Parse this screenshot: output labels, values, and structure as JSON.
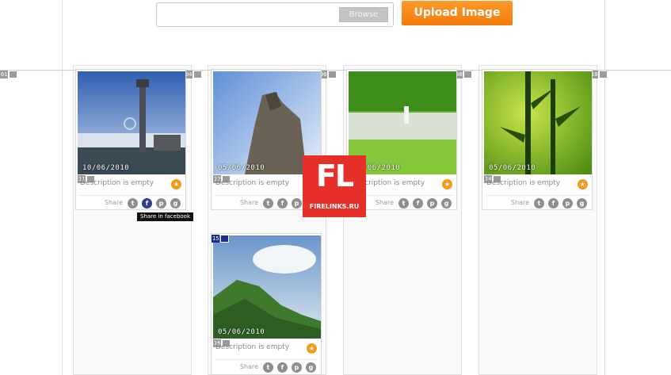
{
  "upload": {
    "field_value": "",
    "browse_label": "Browse",
    "upload_label": "Upload Image"
  },
  "guide_tags": [
    {
      "n": "01",
      "style": "grey"
    },
    {
      "n": "03",
      "style": "blue"
    },
    {
      "n": "04",
      "style": "grey"
    },
    {
      "n": "05",
      "style": "blue"
    },
    {
      "n": "06",
      "style": "grey"
    },
    {
      "n": "07",
      "style": "blue"
    },
    {
      "n": "08",
      "style": "grey"
    },
    {
      "n": "09",
      "style": "blue"
    },
    {
      "n": "10",
      "style": "grey"
    }
  ],
  "cards": [
    {
      "date": "10/06/2010",
      "caption": "Description is empty",
      "sub_tag": "11",
      "share_label": "Share"
    },
    {
      "date": "05/06/2010",
      "caption": "Description is empty",
      "sub_tag": "12",
      "share_label": "Share"
    },
    {
      "date": "05/06/2010",
      "caption": "Description is empty",
      "sub_tag": "13",
      "share_label": "Share"
    },
    {
      "date": "05/06/2010",
      "caption": "Description is empty",
      "sub_tag": "14",
      "share_label": "Share"
    },
    {
      "date": "05/06/2010",
      "caption": "Description is empty",
      "top_tag": "15",
      "sub_tag": "16",
      "share_label": "Share"
    }
  ],
  "social_icons": [
    "twitter-icon",
    "facebook-icon",
    "pinterest-icon",
    "google-icon"
  ],
  "tooltip": "Share in facebook",
  "watermark": {
    "big": "FL",
    "small": "FIRELINKS.RU"
  },
  "colors": {
    "accent": "#f27a0a",
    "badge_blue": "#1d2a8f",
    "watermark_red": "#e8302a"
  }
}
